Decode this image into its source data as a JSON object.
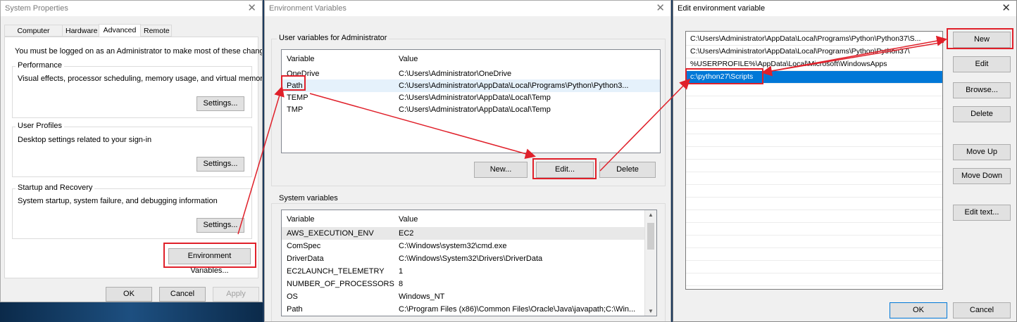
{
  "system_properties": {
    "title": "System Properties",
    "tabs": [
      "Computer Name",
      "Hardware",
      "Advanced",
      "Remote"
    ],
    "active_tab": "Advanced",
    "admin_notice": "You must be logged on as an Administrator to make most of these changes.",
    "performance": {
      "label": "Performance",
      "desc": "Visual effects, processor scheduling, memory usage, and virtual memory",
      "button": "Settings..."
    },
    "user_profiles": {
      "label": "User Profiles",
      "desc": "Desktop settings related to your sign-in",
      "button": "Settings..."
    },
    "startup": {
      "label": "Startup and Recovery",
      "desc": "System startup, system failure, and debugging information",
      "button": "Settings..."
    },
    "env_button": "Environment Variables...",
    "ok": "OK",
    "cancel": "Cancel",
    "apply": "Apply"
  },
  "environment_variables": {
    "title": "Environment Variables",
    "user_group": "User variables for Administrator",
    "col_variable": "Variable",
    "col_value": "Value",
    "user_vars": [
      {
        "name": "OneDrive",
        "value": "C:\\Users\\Administrator\\OneDrive"
      },
      {
        "name": "Path",
        "value": "C:\\Users\\Administrator\\AppData\\Local\\Programs\\Python\\Python3..."
      },
      {
        "name": "TEMP",
        "value": "C:\\Users\\Administrator\\AppData\\Local\\Temp"
      },
      {
        "name": "TMP",
        "value": "C:\\Users\\Administrator\\AppData\\Local\\Temp"
      }
    ],
    "new_button": "New...",
    "edit_button": "Edit...",
    "delete_button": "Delete",
    "system_group": "System variables",
    "system_vars": [
      {
        "name": "AWS_EXECUTION_ENV",
        "value": "EC2"
      },
      {
        "name": "ComSpec",
        "value": "C:\\Windows\\system32\\cmd.exe"
      },
      {
        "name": "DriverData",
        "value": "C:\\Windows\\System32\\Drivers\\DriverData"
      },
      {
        "name": "EC2LAUNCH_TELEMETRY",
        "value": "1"
      },
      {
        "name": "NUMBER_OF_PROCESSORS",
        "value": "8"
      },
      {
        "name": "OS",
        "value": "Windows_NT"
      },
      {
        "name": "Path",
        "value": "C:\\Program Files (x86)\\Common Files\\Oracle\\Java\\javapath;C:\\Win..."
      }
    ]
  },
  "edit_env_variable": {
    "title": "Edit environment variable",
    "entries": [
      "C:\\Users\\Administrator\\AppData\\Local\\Programs\\Python\\Python37\\S...",
      "C:\\Users\\Administrator\\AppData\\Local\\Programs\\Python\\Python37\\",
      "%USERPROFILE%\\AppData\\Local\\Microsoft\\WindowsApps",
      "c:\\python27\\Scripts"
    ],
    "selected_entry": 3,
    "buttons": {
      "new": "New",
      "edit": "Edit",
      "browse": "Browse...",
      "delete": "Delete",
      "move_up": "Move Up",
      "move_down": "Move Down",
      "edit_text": "Edit text..."
    },
    "ok": "OK",
    "cancel": "Cancel"
  },
  "colors": {
    "annotation": "#e0202a",
    "selection": "#0078d7"
  }
}
